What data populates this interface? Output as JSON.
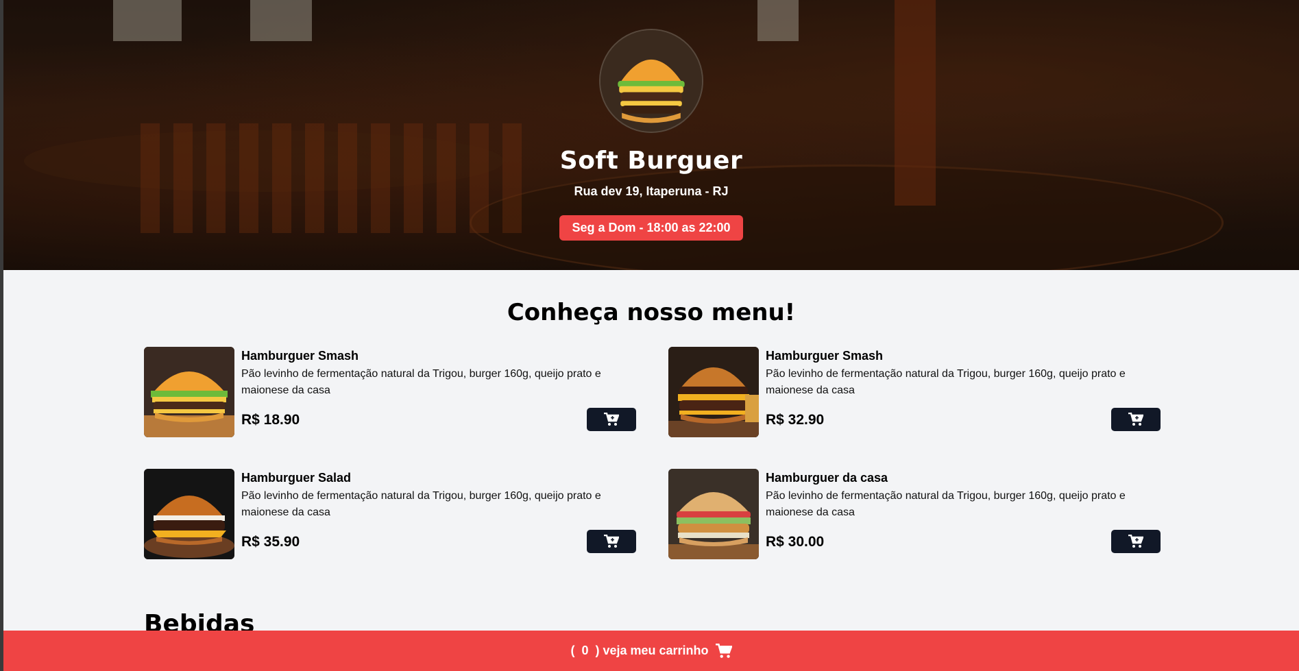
{
  "header": {
    "title": "Soft Burguer",
    "address": "Rua dev 19, Itaperuna - RJ",
    "hours": "Seg a Dom - 18:00 as 22:00"
  },
  "menu": {
    "heading": "Conheça nosso menu!",
    "items": [
      {
        "name": "Hamburguer Smash",
        "description": "Pão levinho de fermentação natural da Trigou, burger 160g, queijo prato e maionese da casa",
        "price": "R$ 18.90"
      },
      {
        "name": "Hamburguer Smash",
        "description": "Pão levinho de fermentação natural da Trigou, burger 160g, queijo prato e maionese da casa",
        "price": "R$ 32.90"
      },
      {
        "name": "Hamburguer Salad",
        "description": "Pão levinho de fermentação natural da Trigou, burger 160g, queijo prato e maionese da casa",
        "price": "R$ 35.90"
      },
      {
        "name": "Hamburguer da casa",
        "description": "Pão levinho de fermentação natural da Trigou, burger 160g, queijo prato e maionese da casa",
        "price": "R$ 30.00"
      }
    ]
  },
  "drinks": {
    "heading": "Bebidas"
  },
  "footer": {
    "open_paren": "(",
    "count": "0",
    "label": ") veja meu carrinho"
  },
  "colors": {
    "accent": "#ef4444",
    "button": "#111827",
    "background": "#f3f4f6"
  },
  "icons": {
    "cart_add": "cart-plus-icon",
    "cart": "cart-icon"
  }
}
